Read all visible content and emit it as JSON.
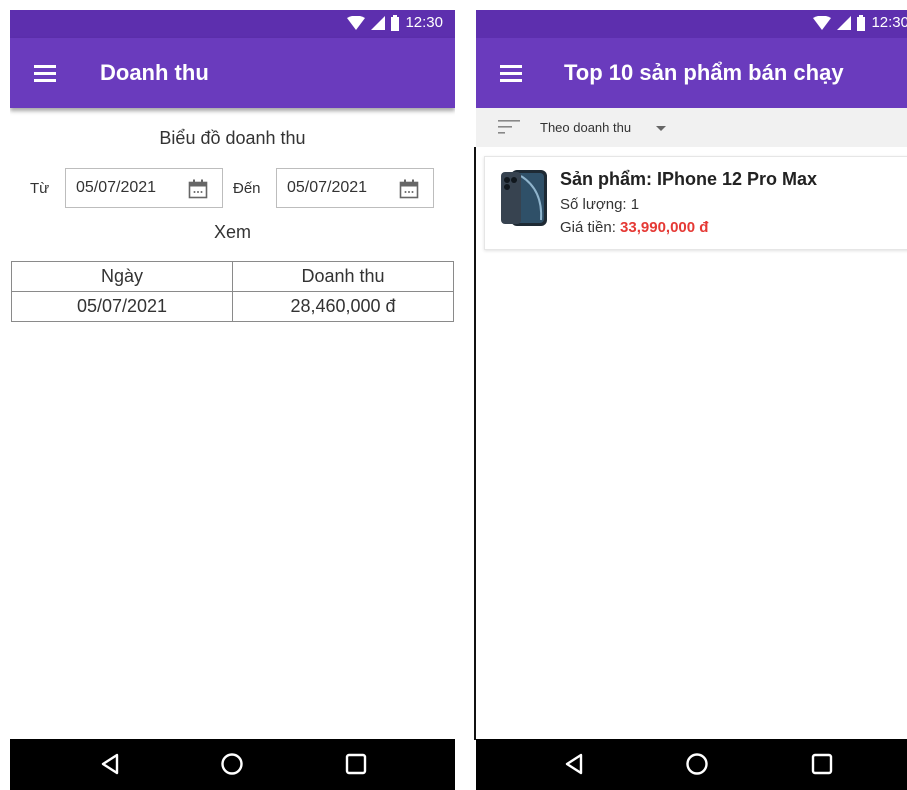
{
  "left": {
    "status": {
      "time": "12:30"
    },
    "appbar": {
      "title": "Doanh thu"
    },
    "chart_title": "Biểu đồ doanh thu",
    "from_label": "Từ",
    "from_date": "05/07/2021",
    "to_label": "Đến",
    "to_date": "05/07/2021",
    "view_button": "Xem",
    "table": {
      "headers": [
        "Ngày",
        "Doanh thu"
      ],
      "rows": [
        [
          "05/07/2021",
          "28,460,000 đ"
        ]
      ]
    }
  },
  "right": {
    "status": {
      "time": "12:30"
    },
    "appbar": {
      "title": "Top 10 sản phẩm bán chạy"
    },
    "sort": {
      "label": "Theo doanh thu"
    },
    "products": [
      {
        "name": "Sản phẩm: IPhone 12 Pro Max",
        "qty_label": "Số lượng:",
        "qty": "1",
        "price_label": "Giá tiền:",
        "price": "33,990,000 đ"
      }
    ]
  },
  "theme": {
    "statusbar": "#5d2fae",
    "appbar": "#6a3bbd",
    "price": "#e53935",
    "navbar": "#000000"
  },
  "icons": {
    "menu": "menu-icon",
    "calendar": "calendar-icon",
    "sort": "sort-icon",
    "back": "back-icon",
    "home": "home-icon",
    "recents": "recents-icon"
  }
}
